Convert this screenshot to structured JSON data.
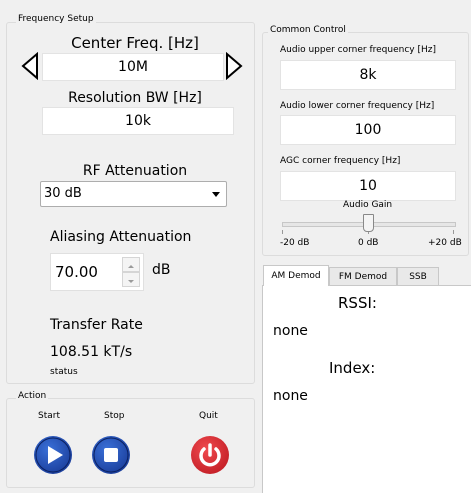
{
  "frequency_setup": {
    "group_title": "Frequency Setup",
    "center_freq_label": "Center Freq. [Hz]",
    "center_freq_value": "10M",
    "resolution_bw_label": "Resolution BW [Hz]",
    "resolution_bw_value": "10k",
    "rf_attenuation_label": "RF Attenuation",
    "rf_attenuation_selected": "30 dB",
    "aliasing_attenuation_label": "Aliasing Attenuation",
    "aliasing_attenuation_value": "70.00",
    "aliasing_unit": "dB",
    "transfer_rate_label": "Transfer Rate",
    "transfer_rate_value": "108.51 kT/s",
    "status_text": "status"
  },
  "action": {
    "group_title": "Action",
    "start_label": "Start",
    "stop_label": "Stop",
    "quit_label": "Quit",
    "colors": {
      "start": "#1a3f9c",
      "stop": "#1a3f9c",
      "quit": "#e0232d"
    }
  },
  "common_control": {
    "group_title": "Common Control",
    "upper_label": "Audio upper corner frequency [Hz]",
    "upper_value": "8k",
    "lower_label": "Audio lower corner frequency [Hz]",
    "lower_value": "100",
    "agc_label": "AGC corner frequency [Hz]",
    "agc_value": "10",
    "audio_gain_label": "Audio Gain",
    "gain_min": "-20 dB",
    "gain_mid": "0 dB",
    "gain_max": "+20 dB",
    "gain_level_db": 0
  },
  "demod_tabs": {
    "tabs": [
      "AM Demod",
      "FM Demod",
      "SSB"
    ],
    "active": "AM Demod",
    "rssi_label": "RSSI:",
    "rssi_value": "none",
    "index_label": "Index:",
    "index_value": "none"
  }
}
